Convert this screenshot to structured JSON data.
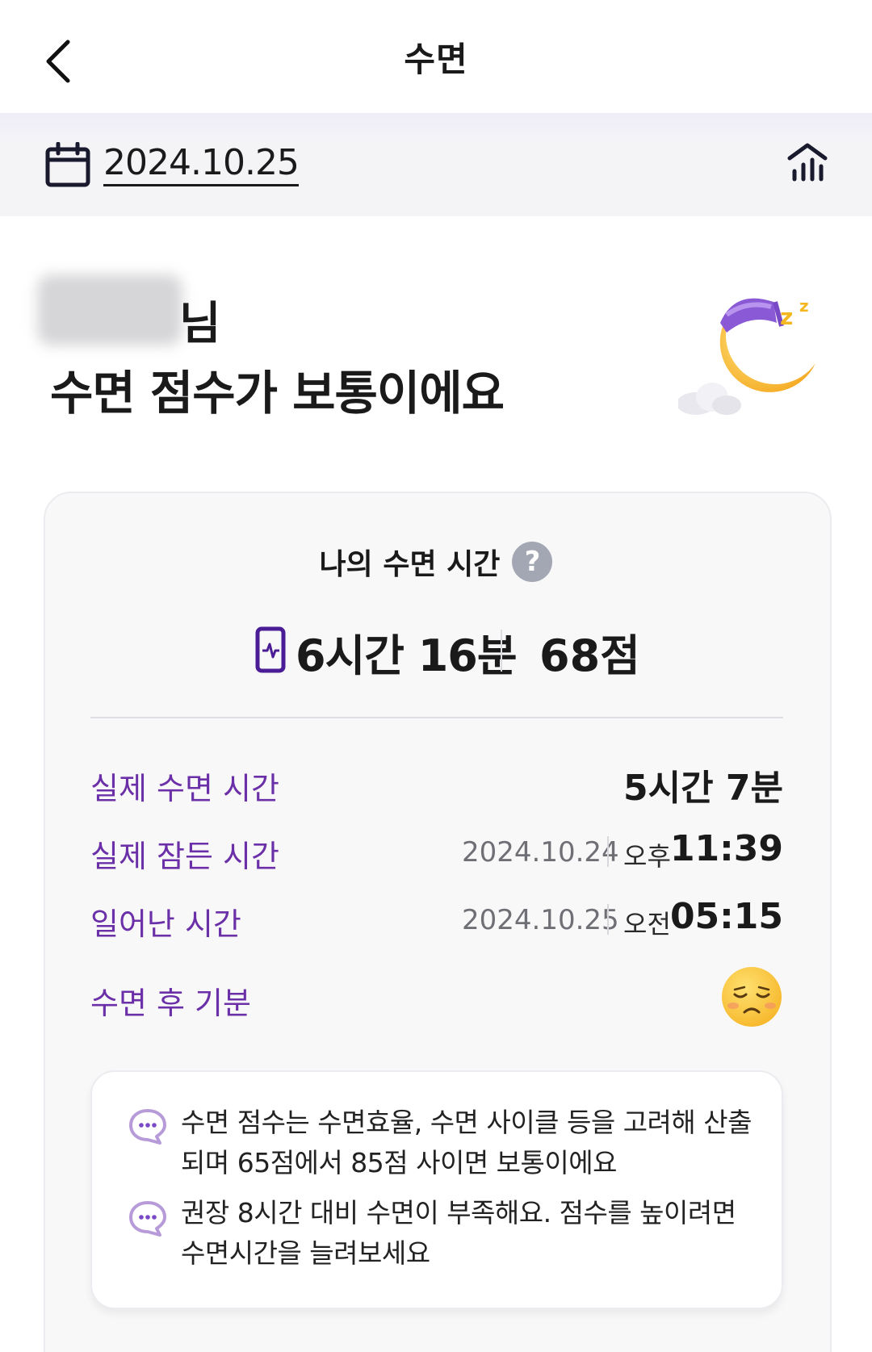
{
  "header": {
    "title": "수면",
    "back_icon": "chevron-left-icon"
  },
  "datebar": {
    "date": "2024.10.25",
    "calendar_icon": "calendar-icon",
    "stats_icon": "stats-chart-icon"
  },
  "greeting": {
    "suffix": "님",
    "headline": "수면 점수가 보통이에요",
    "illustration": "sleeping-moon-icon"
  },
  "card": {
    "title": "나의 수면 시간",
    "help_label": "?",
    "duration": "6시간 16분",
    "score": "68점",
    "rows": {
      "actual_sleep": {
        "label": "실제 수면 시간",
        "value": "5시간 7분"
      },
      "fell_asleep": {
        "label": "실제 잠든 시간",
        "date": "2024.10.24",
        "ampm": "오후",
        "time": "11:39"
      },
      "woke_up": {
        "label": "일어난 시간",
        "date": "2024.10.25",
        "ampm": "오전",
        "time": "05:15"
      },
      "mood": {
        "label": "수면 후 기분",
        "icon": "tired-face-icon"
      }
    },
    "info": [
      "수면 점수는 수면효율, 수면 사이클 등을 고려해 산출되며 65점에서 85점 사이면 보통이에요",
      "권장 8시간 대비 수면이 부족해요. 점수를 높이려면 수면시간을 늘려보세요"
    ]
  },
  "colors": {
    "accent_purple": "#6b2fa8",
    "icon_purple": "#4a1d96",
    "bubble_purple": "#b79bd9",
    "help_grey": "#a3a7b3"
  }
}
